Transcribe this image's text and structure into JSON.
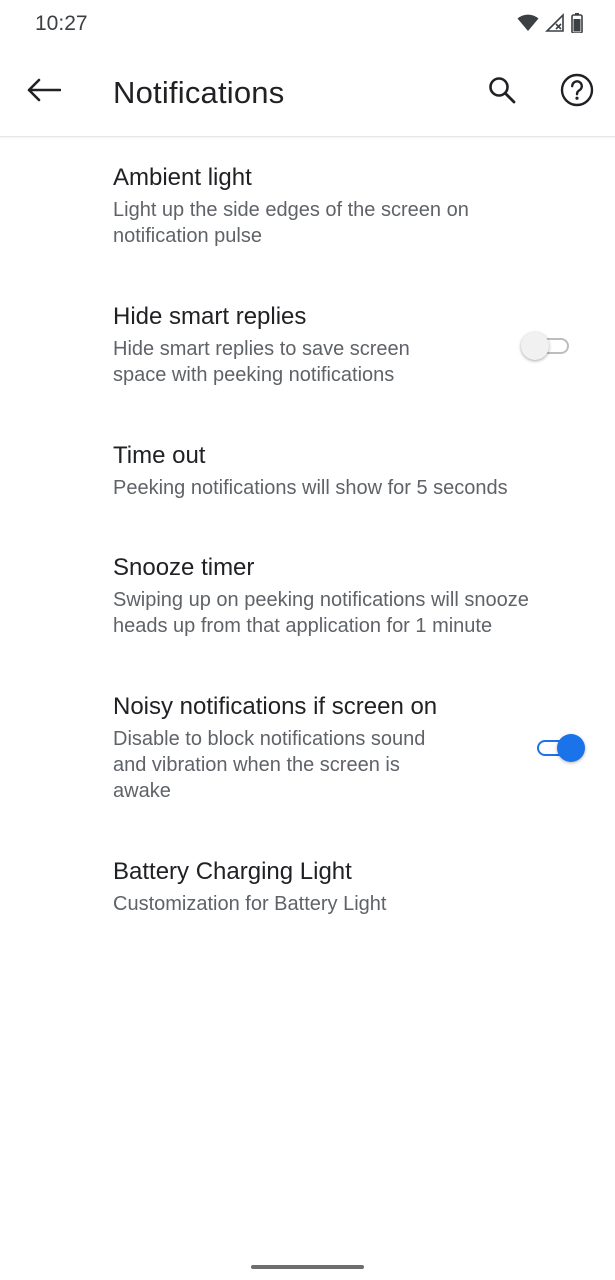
{
  "status_bar": {
    "time": "10:27",
    "icons": [
      "wifi-icon",
      "signal-no-data-icon",
      "battery-icon"
    ]
  },
  "app_bar": {
    "title": "Notifications",
    "back_icon": "arrow-back-icon",
    "search_icon": "search-icon",
    "help_icon": "help-circle-icon"
  },
  "preferences": [
    {
      "title": "Ambient light",
      "summary_lines": [
        "Light up the side edges of the screen on",
        "notification pulse"
      ]
    },
    {
      "title": "Hide smart replies",
      "summary_lines": [
        "Hide smart replies to save screen",
        "space with peeking notifications"
      ],
      "toggle": "off"
    },
    {
      "title": "Time out",
      "summary_lines": [
        "Peeking notifications will show for 5 seconds"
      ]
    },
    {
      "title": "Snooze timer",
      "summary_lines": [
        "Swiping up on peeking notifications will snooze",
        "heads up from that application for 1 minute"
      ]
    },
    {
      "title": "Noisy notifications if screen on",
      "summary_lines": [
        "Disable to block notifications sound",
        "and vibration when the screen is",
        "awake"
      ],
      "toggle": "on"
    },
    {
      "title": "Battery Charging Light",
      "summary_lines": [
        "Customization for Battery Light"
      ]
    }
  ],
  "colors": {
    "accent": "#1a73e8",
    "title_text": "#202124",
    "summary_text": "#5f6368"
  }
}
